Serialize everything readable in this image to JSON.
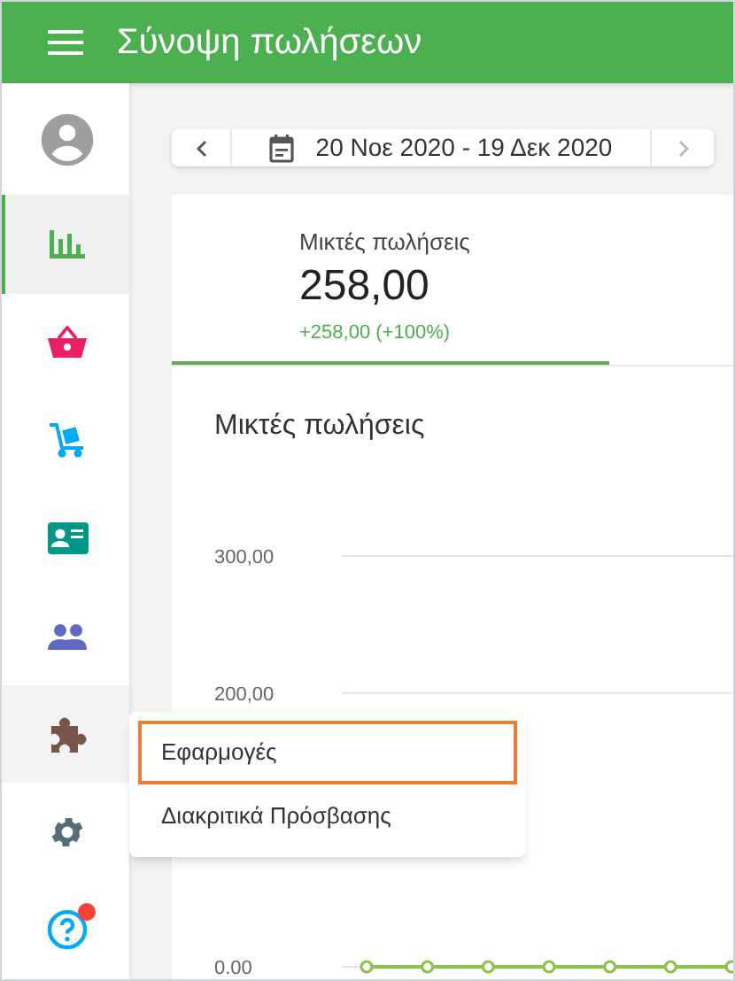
{
  "app_bar": {
    "title": "Σύνοψη πωλήσεων"
  },
  "sidebar": {
    "items": [
      {
        "kind": "profile",
        "selected": false
      },
      {
        "kind": "chart",
        "selected": true
      },
      {
        "kind": "basket",
        "selected": false
      },
      {
        "kind": "cart",
        "selected": false
      },
      {
        "kind": "card",
        "selected": false
      },
      {
        "kind": "people",
        "selected": false
      },
      {
        "kind": "puzzle",
        "selected": false,
        "hovered": true
      },
      {
        "kind": "gear",
        "selected": false
      },
      {
        "kind": "help",
        "selected": false,
        "badge": true
      }
    ]
  },
  "date_range": {
    "label": "20 Νοε 2020 - 19 Δεκ 2020",
    "next_disabled": true
  },
  "metric_tabs": [
    {
      "label": "Μικτές πωλήσεις",
      "value": "258,00",
      "change": "+258,00 (+100%)",
      "selected": true
    }
  ],
  "chart": {
    "title": "Μικτές πωλήσεις",
    "chart_data": {
      "type": "line",
      "yticks": [
        {
          "value": 0,
          "label": "0.00"
        },
        {
          "value": 200,
          "label": "200,00"
        },
        {
          "value": 300,
          "label": "300,00"
        }
      ],
      "ylim": [
        0,
        300
      ],
      "series": [
        {
          "color": "#8bc34a",
          "marker": "circle",
          "values": [
            0,
            0,
            0,
            0,
            0,
            0,
            0
          ]
        }
      ]
    }
  },
  "popup_menu": {
    "items": [
      {
        "label": "Εφαρμογές",
        "highlighted": true
      },
      {
        "label": "Διακριτικά Πρόσβασης",
        "highlighted": false
      }
    ]
  }
}
